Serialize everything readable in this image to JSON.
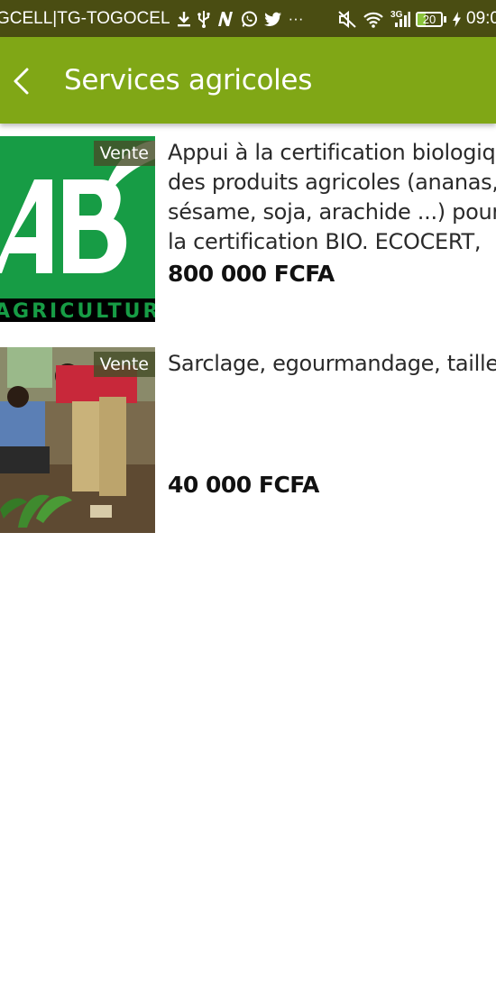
{
  "status_bar": {
    "carrier": "GCELL|TG-TOGOCEL",
    "network_type": "3G",
    "battery_level": "20",
    "time": "09:0"
  },
  "app_bar": {
    "title": "Services agricoles"
  },
  "listings": [
    {
      "badge": "Vente",
      "description_lines": [
        "Appui à la certification biologique",
        "des produits agricoles (ananas,",
        "sésame, soja, arachide ...) pour",
        "la certification BIO. ECOCERT,"
      ],
      "price": "800 000 FCFA",
      "image_text": "AB",
      "image_subtext": "AGRICULTURE"
    },
    {
      "badge": "Vente",
      "description_lines": [
        "Sarclage, egourmandage, taille"
      ],
      "price": "40 000 FCFA"
    }
  ],
  "colors": {
    "status_bar_bg": "#4a4d12",
    "app_bar_bg": "#80a716",
    "ab_logo_green": "#179c45"
  }
}
